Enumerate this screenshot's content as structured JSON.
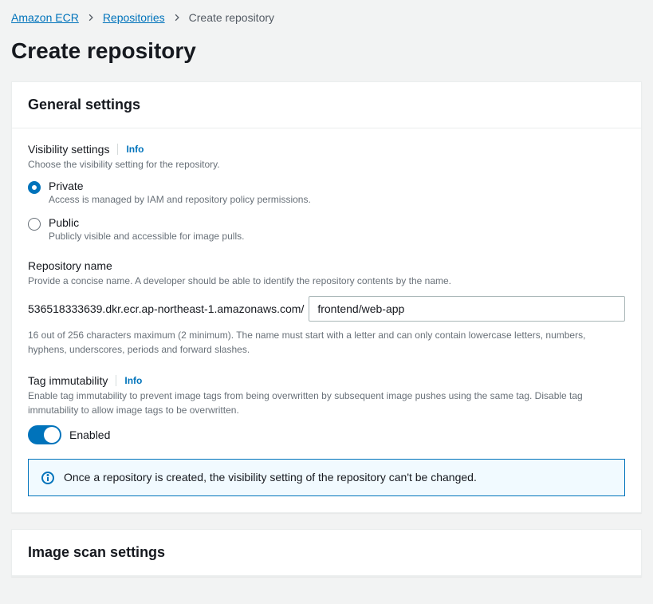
{
  "breadcrumb": {
    "items": [
      {
        "label": "Amazon ECR"
      },
      {
        "label": "Repositories"
      }
    ],
    "current": "Create repository"
  },
  "page_title": "Create repository",
  "panels": {
    "general": {
      "title": "General settings",
      "visibility": {
        "label": "Visibility settings",
        "info": "Info",
        "description": "Choose the visibility setting for the repository.",
        "options": {
          "private": {
            "label": "Private",
            "description": "Access is managed by IAM and repository policy permissions."
          },
          "public": {
            "label": "Public",
            "description": "Publicly visible and accessible for image pulls."
          }
        }
      },
      "repo_name": {
        "label": "Repository name",
        "description": "Provide a concise name. A developer should be able to identify the repository contents by the name.",
        "prefix": "536518333639.dkr.ecr.ap-northeast-1.amazonaws.com/",
        "value": "frontend/web-app",
        "constraint": "16 out of 256 characters maximum (2 minimum). The name must start with a letter and can only contain lowercase letters, numbers, hyphens, underscores, periods and forward slashes."
      },
      "tag_immutability": {
        "label": "Tag immutability",
        "info": "Info",
        "description": "Enable tag immutability to prevent image tags from being overwritten by subsequent image pushes using the same tag. Disable tag immutability to allow image tags to be overwritten.",
        "toggle_label": "Enabled"
      },
      "alert": "Once a repository is created, the visibility setting of the repository can't be changed."
    },
    "image_scan": {
      "title": "Image scan settings"
    }
  }
}
